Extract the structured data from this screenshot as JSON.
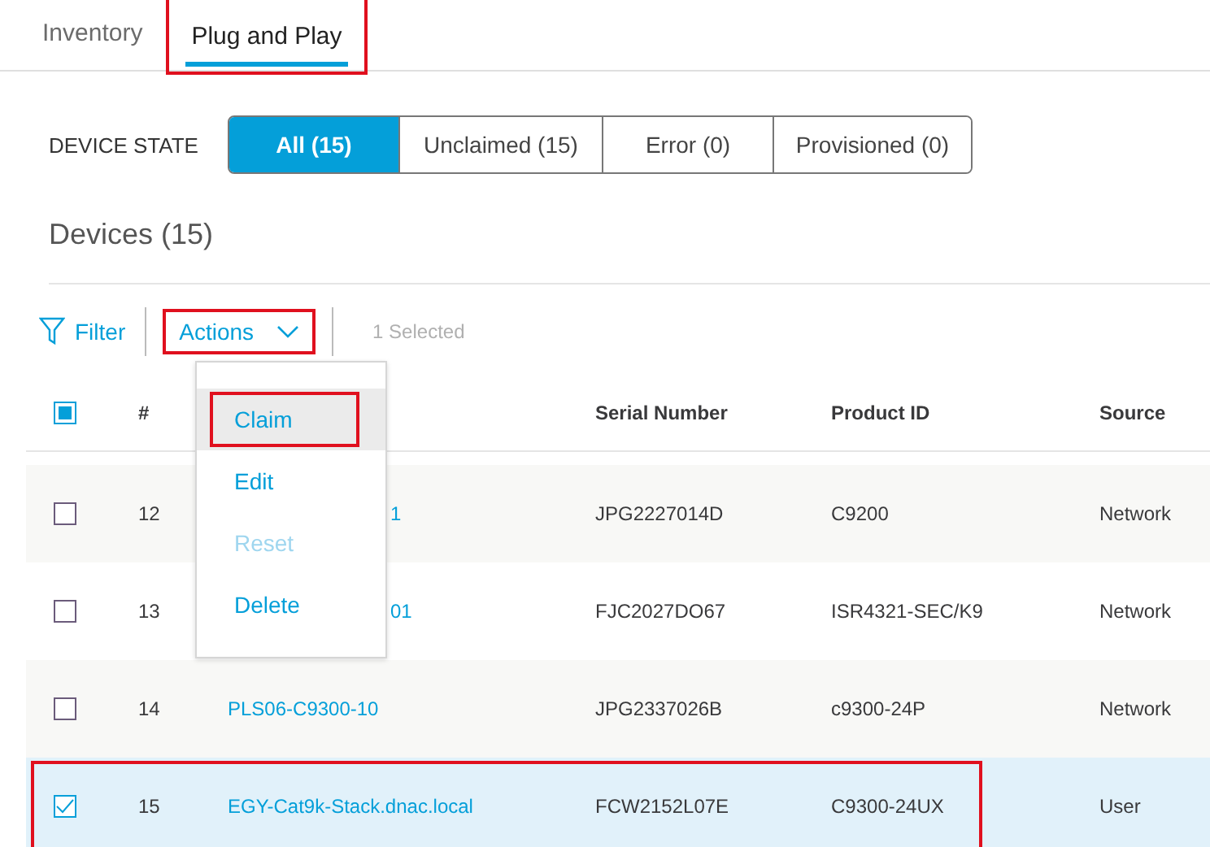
{
  "tabs": [
    {
      "label": "Inventory",
      "selected": false,
      "highlighted": false
    },
    {
      "label": "Plug and Play",
      "selected": true,
      "highlighted": true
    }
  ],
  "device_state": {
    "label": "DEVICE STATE",
    "options": [
      {
        "label": "All (15)",
        "selected": true
      },
      {
        "label": "Unclaimed (15)",
        "selected": false
      },
      {
        "label": "Error (0)",
        "selected": false
      },
      {
        "label": "Provisioned (0)",
        "selected": false
      }
    ]
  },
  "heading": "Devices (15)",
  "toolbar": {
    "filter": "Filter",
    "actions": {
      "label": "Actions",
      "highlighted": true
    },
    "selection_count": "1 Selected"
  },
  "actions_menu": [
    {
      "label": "Claim",
      "hovered": true,
      "highlighted": true,
      "disabled": false
    },
    {
      "label": "Edit",
      "hovered": false,
      "highlighted": false,
      "disabled": false
    },
    {
      "label": "Reset",
      "hovered": false,
      "highlighted": false,
      "disabled": true
    },
    {
      "label": "Delete",
      "hovered": false,
      "highlighted": false,
      "disabled": false
    }
  ],
  "table": {
    "select_all": {
      "indeterminate": true
    },
    "columns": [
      "#",
      "Serial Number",
      "Product ID",
      "Source"
    ],
    "rows": [
      {
        "number": "12",
        "name": "1",
        "kind": "covered",
        "serial": "JPG2227014D",
        "product_id": "C9200",
        "source": "Network",
        "checked": false,
        "highlighted": false
      },
      {
        "number": "13",
        "name": "01",
        "kind": "covered",
        "serial": "FJC2027DO67",
        "product_id": "ISR4321-SEC/K9",
        "source": "Network",
        "checked": false,
        "highlighted": false
      },
      {
        "number": "14",
        "name": "PLS06-C9300-10",
        "kind": "full",
        "serial": "JPG2337026B",
        "product_id": "c9300-24P",
        "source": "Network",
        "checked": false,
        "highlighted": false
      },
      {
        "number": "15",
        "name": "EGY-Cat9k-Stack.dnac.local",
        "kind": "full",
        "serial": "FCW2152L07E",
        "product_id": "C9300-24UX",
        "source": "User",
        "checked": true,
        "highlighted": true
      }
    ]
  }
}
